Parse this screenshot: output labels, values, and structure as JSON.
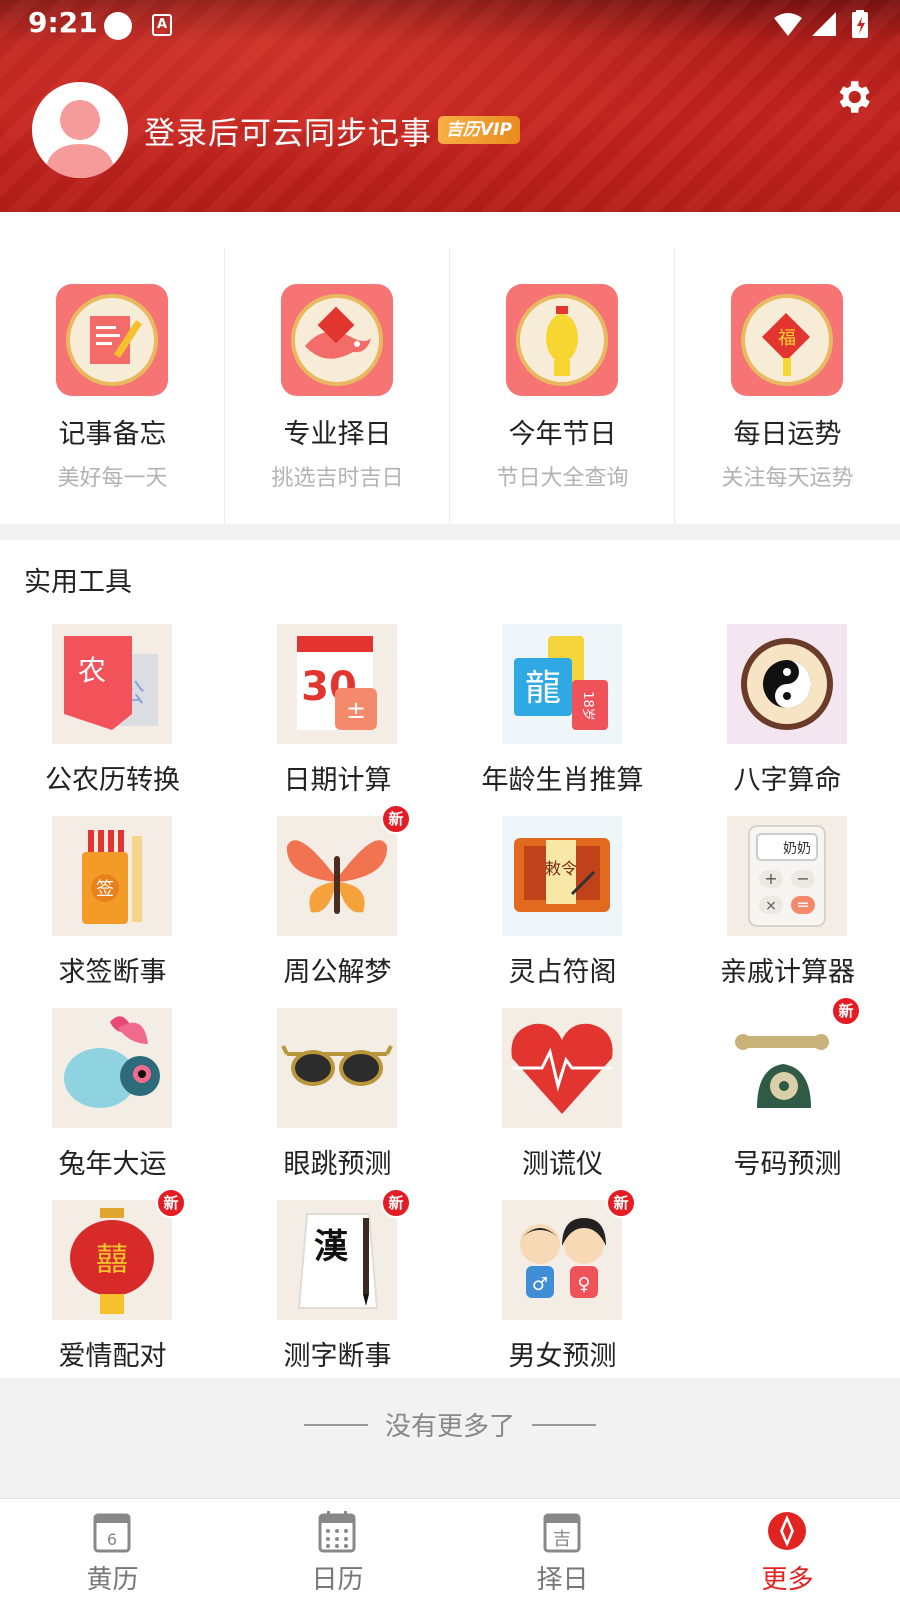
{
  "status_bar": {
    "time": "9:21",
    "app_glyph": "A"
  },
  "header": {
    "login_prompt": "登录后可云同步记事",
    "vip_badge": "吉历VIP",
    "settings_icon": "gear-icon",
    "accent": "#c5241f"
  },
  "features": [
    {
      "title": "记事备忘",
      "subtitle": "美好每一天",
      "icon": "notepad-pencil-icon"
    },
    {
      "title": "专业择日",
      "subtitle": "挑选吉时吉日",
      "icon": "koi-fish-icon"
    },
    {
      "title": "今年节日",
      "subtitle": "节日大全查询",
      "icon": "lantern-icon"
    },
    {
      "title": "每日运势",
      "subtitle": "关注每天运势",
      "icon": "fortune-knot-icon"
    }
  ],
  "tools_section": {
    "title": "实用工具",
    "new_label": "新",
    "items": [
      {
        "label": "公农历转换",
        "icon": "calendar-convert-icon",
        "icon_text_1": "农",
        "icon_text_2": "公",
        "is_new": false
      },
      {
        "label": "日期计算",
        "icon": "date-calculator-icon",
        "icon_text_1": "30",
        "is_new": false
      },
      {
        "label": "年龄生肖推算",
        "icon": "dragon-zodiac-icon",
        "icon_text_1": "龍",
        "icon_text_2": "18岁",
        "is_new": false
      },
      {
        "label": "八字算命",
        "icon": "yin-yang-icon",
        "is_new": false
      },
      {
        "label": "求签断事",
        "icon": "fortune-sticks-icon",
        "icon_text_1": "签",
        "is_new": false
      },
      {
        "label": "周公解梦",
        "icon": "butterfly-icon",
        "is_new": true
      },
      {
        "label": "灵占符阁",
        "icon": "talisman-icon",
        "icon_text_1": "敕令",
        "is_new": false
      },
      {
        "label": "亲戚计算器",
        "icon": "relative-calculator-icon",
        "icon_text_1": "奶奶",
        "is_new": false
      },
      {
        "label": "兔年大运",
        "icon": "rabbit-icon",
        "is_new": false
      },
      {
        "label": "眼跳预测",
        "icon": "sunglasses-icon",
        "is_new": false
      },
      {
        "label": "测谎仪",
        "icon": "heart-pulse-icon",
        "is_new": false
      },
      {
        "label": "号码预测",
        "icon": "telephone-icon",
        "is_new": true
      },
      {
        "label": "爱情配对",
        "icon": "double-happiness-lantern-icon",
        "icon_text_1": "囍",
        "is_new": true
      },
      {
        "label": "测字断事",
        "icon": "calligraphy-icon",
        "icon_text_1": "漢",
        "is_new": true
      },
      {
        "label": "男女预测",
        "icon": "boy-girl-icon",
        "is_new": true
      }
    ]
  },
  "footer": {
    "no_more": "没有更多了"
  },
  "bottom_nav": [
    {
      "label": "黄历",
      "icon": "almanac-icon",
      "icon_text": "6",
      "active": false
    },
    {
      "label": "日历",
      "icon": "calendar-icon",
      "active": false
    },
    {
      "label": "择日",
      "icon": "auspicious-day-icon",
      "icon_text": "吉",
      "active": false
    },
    {
      "label": "更多",
      "icon": "compass-icon",
      "active": true
    }
  ],
  "colors": {
    "active": "#e22420",
    "feature_tile": "#f67473",
    "new_badge": "#e51c23"
  }
}
